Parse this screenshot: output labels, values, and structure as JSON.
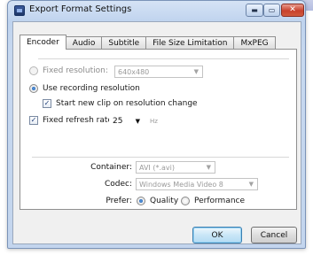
{
  "window": {
    "title": "Export Format Settings",
    "minimize_glyph": "▬",
    "maximize_glyph": "▭",
    "close_glyph": "✕"
  },
  "tabs": [
    {
      "label": "Encoder",
      "active": true
    },
    {
      "label": "Audio",
      "active": false
    },
    {
      "label": "Subtitle",
      "active": false
    },
    {
      "label": "File Size Limitation",
      "active": false
    },
    {
      "label": "MxPEG",
      "active": false
    }
  ],
  "encoder": {
    "fixed_resolution": {
      "label": "Fixed resolution:",
      "selected": false,
      "value": "640x480",
      "enabled": false
    },
    "use_recording_resolution": {
      "label": "Use recording resolution",
      "selected": true
    },
    "start_new_clip": {
      "label": "Start new clip on resolution change",
      "checked": true
    },
    "fixed_refresh_rate": {
      "label": "Fixed refresh rate:",
      "checked": true,
      "value": "25",
      "unit": "Hz"
    },
    "container": {
      "label": "Container:",
      "value": "AVI (*.avi)",
      "enabled": false
    },
    "codec": {
      "label": "Codec:",
      "value": "Windows Media Video 8",
      "enabled": false
    },
    "prefer": {
      "label": "Prefer:",
      "options": [
        {
          "label": "Quality",
          "selected": true
        },
        {
          "label": "Performance",
          "selected": false
        }
      ]
    }
  },
  "buttons": {
    "ok": "OK",
    "cancel": "Cancel"
  },
  "icons": {
    "dropdown_arrow": "▼",
    "check_mark": "✓"
  },
  "colors": {
    "titlebar": "#c7d8ef",
    "close_button": "#c8412c",
    "default_button_border": "#3c7fb1",
    "radio_selected": "#1f5aa8"
  }
}
